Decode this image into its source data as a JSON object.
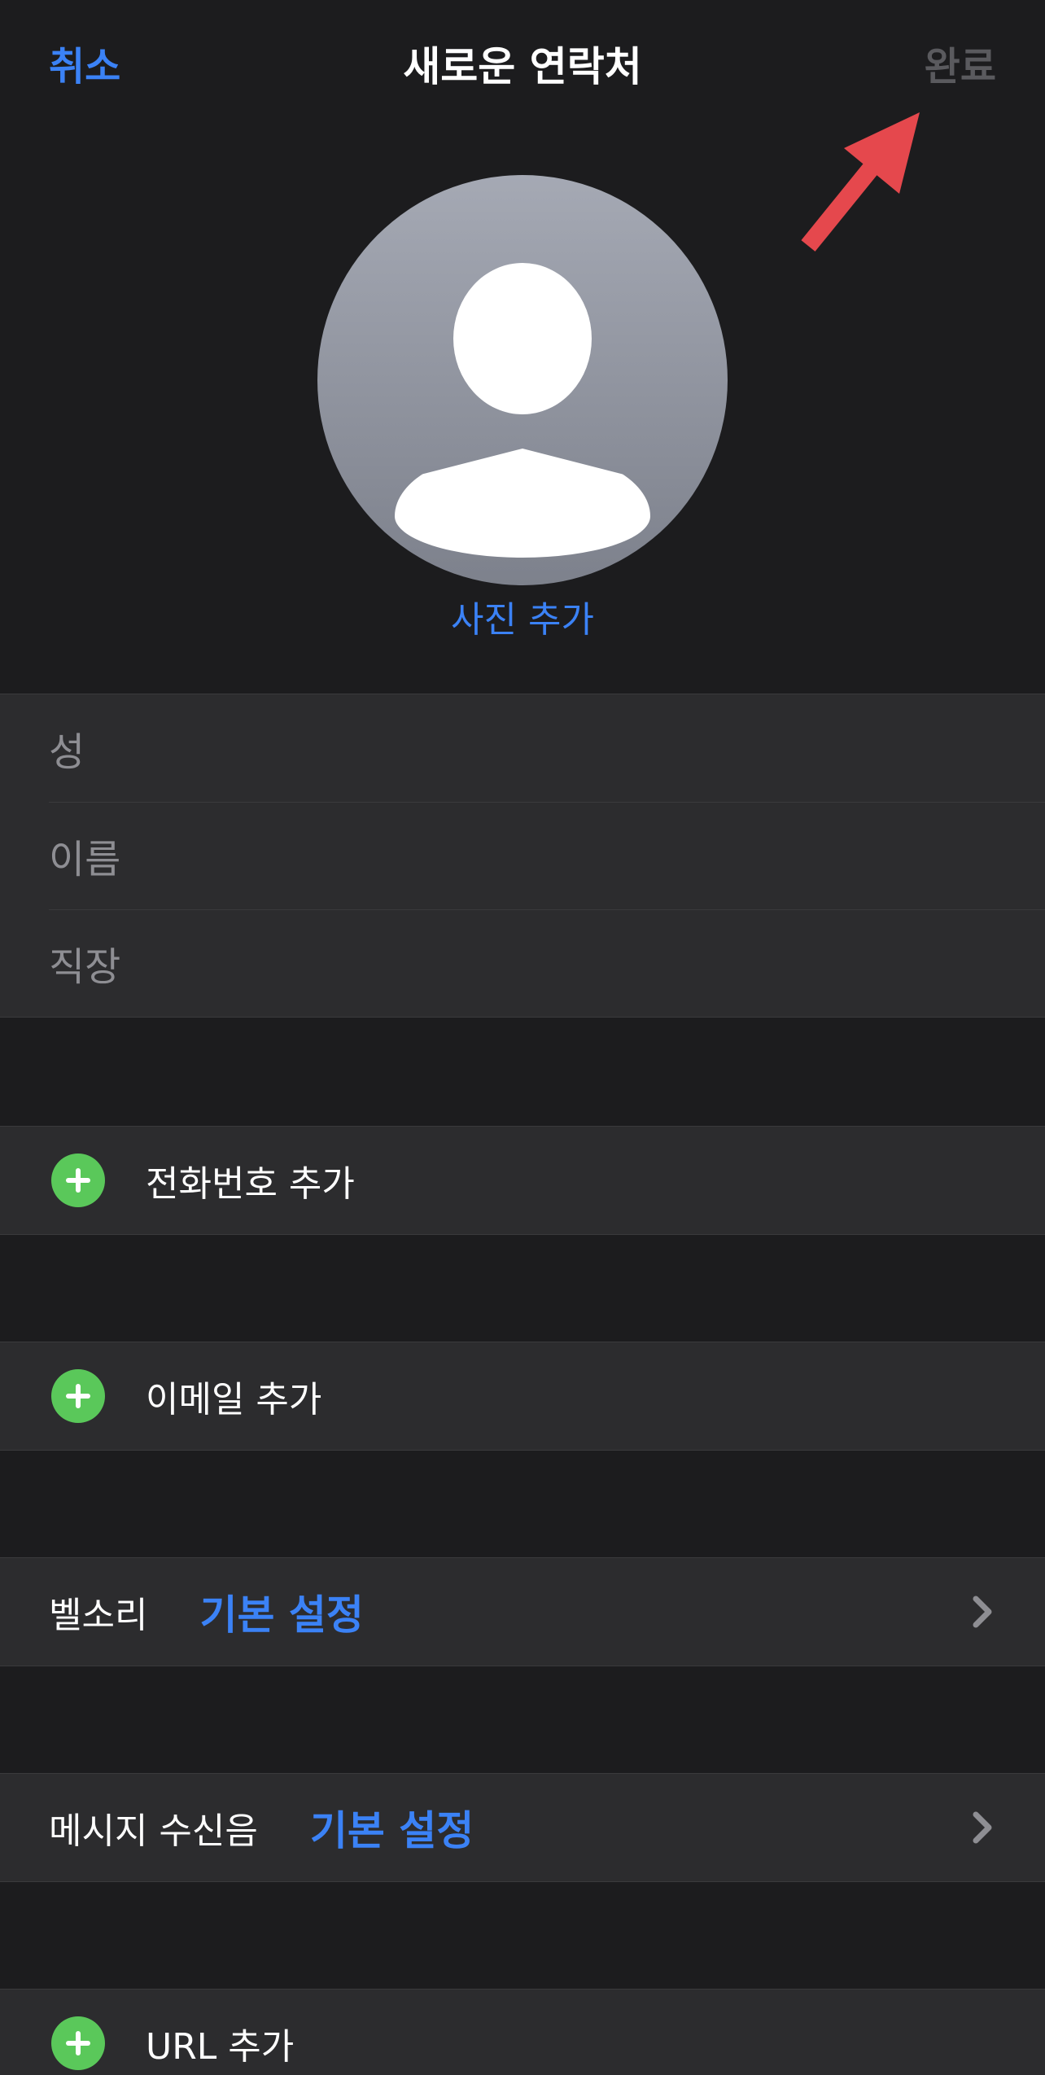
{
  "nav": {
    "cancel": "취소",
    "title": "새로운 연락처",
    "done": "완료"
  },
  "avatar": {
    "add_photo": "사진 추가"
  },
  "name_fields": {
    "last_name_placeholder": "성",
    "first_name_placeholder": "이름",
    "company_placeholder": "직장"
  },
  "actions": {
    "add_phone": "전화번호 추가",
    "add_email": "이메일 추가",
    "add_url": "URL 추가"
  },
  "ringtone": {
    "label": "벨소리",
    "value": "기본 설정"
  },
  "text_tone": {
    "label": "메시지 수신음",
    "value": "기본 설정"
  },
  "colors": {
    "accent": "#3b82f6",
    "add_button": "#5ac85a",
    "annotation_arrow": "#e5484d",
    "background": "#1c1c1e",
    "cell": "#2c2c2e"
  },
  "icons": [
    "person-silhouette-icon",
    "plus-circle-icon",
    "chevron-right-icon",
    "annotation-arrow"
  ]
}
